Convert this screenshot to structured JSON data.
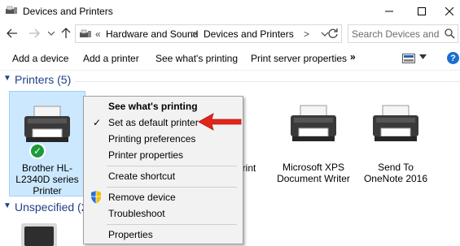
{
  "window": {
    "title": "Devices and Printers"
  },
  "address": {
    "root_sep": "«",
    "crumb1": "Hardware and Sound",
    "crumb2": "Devices and Printers",
    "chevron": ">"
  },
  "search": {
    "placeholder": "Search Devices and P..."
  },
  "commands": {
    "add_device": "Add a device",
    "add_printer": "Add a printer",
    "see_printing": "See what's printing",
    "server_props": "Print server properties",
    "more": "»",
    "help": "?"
  },
  "groups": {
    "printers": "Printers (5)",
    "unspecified": "Unspecified (2)"
  },
  "devices": [
    {
      "label": "Brother HL-L2340D series Printer"
    },
    {
      "label": "rint"
    },
    {
      "label": "Microsoft XPS Document Writer"
    },
    {
      "label": "Send To OneNote 2016"
    }
  ],
  "menu": {
    "items": [
      {
        "label": "See what's printing"
      },
      {
        "label": "Set as default printer",
        "check": "✓"
      },
      {
        "label": "Printing preferences"
      },
      {
        "label": "Printer properties"
      },
      {
        "label": "Create shortcut"
      },
      {
        "label": "Remove device"
      },
      {
        "label": "Troubleshoot"
      },
      {
        "label": "Properties"
      }
    ]
  },
  "colors": {
    "selection": "#cce8ff",
    "group_header": "#1e3f8a",
    "default_check": "#1e9a3a",
    "arrow": "#e0251b",
    "help": "#1a6fcf"
  }
}
